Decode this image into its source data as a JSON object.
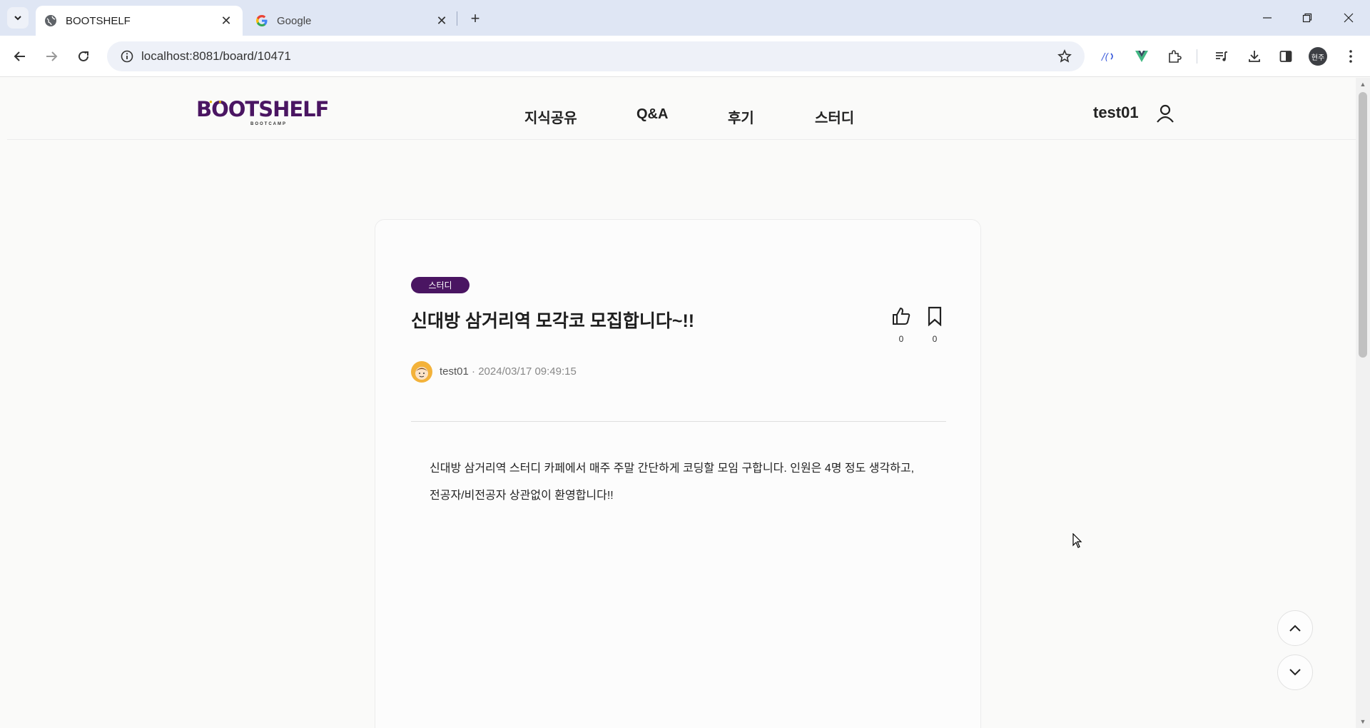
{
  "browser": {
    "tabs": [
      {
        "title": "BOOTSHELF",
        "active": true
      },
      {
        "title": "Google",
        "active": false
      }
    ],
    "url": "localhost:8081/board/10471",
    "profile_initials": "현주"
  },
  "site": {
    "logo_text": "BOOTSHELF",
    "logo_sub": "BOOTCAMP",
    "menu": [
      "지식공유",
      "Q&A",
      "후기",
      "스터디"
    ],
    "user_name": "test01"
  },
  "post": {
    "category": "스터디",
    "title": "신대방 삼거리역 모각코 모집합니다~!!",
    "like_count": "0",
    "bookmark_count": "0",
    "author": "test01",
    "date": "· 2024/03/17 09:49:15",
    "body": [
      "신대방 삼거리역 스터디 카페에서 매주 주말 간단하게 코딩할 모임 구합니다. 인원은 4명 정도 생각하고,",
      "전공자/비전공자 상관없이 환영합니다!!"
    ]
  },
  "colors": {
    "brand": "#4a1562",
    "avatar": "#f3b23a"
  }
}
